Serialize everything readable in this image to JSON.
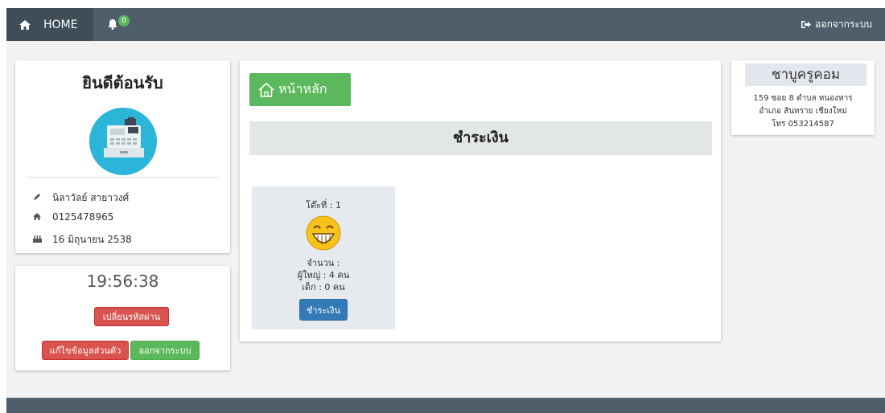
{
  "navbar": {
    "home_label": "HOME",
    "home_icon": "home-icon",
    "bell_icon": "bell-icon",
    "notification_count": "0",
    "logout_label": "ออกจากระบบ",
    "logout_icon": "sign-out-icon",
    "color": "#4e5f6b"
  },
  "profile": {
    "welcome": "ยินดีต้อนรับ",
    "avatar_icon": "cash-register-icon",
    "name": "นิลาวัลย์ สายาวงศ์",
    "name_icon": "pencil-icon",
    "phone": "0125478965",
    "phone_icon": "home-icon",
    "birthday": "16 มิถุนายน 2538",
    "birthday_icon": "cake-icon"
  },
  "clock_panel": {
    "time": "19:56:38",
    "change_password_label": "เปลี่ยนรหัสผ่าน",
    "edit_profile_label": "แก้ไขข้อมูลส่วนตัว",
    "logout_label": "ออกจากระบบ"
  },
  "main": {
    "home_button_label": "หน้าหลัก",
    "section_title": "ชำระเงิน",
    "tables": [
      {
        "table_label": "โต๊ะที่ : 1",
        "count_label": "จำนวน :",
        "adults": "ผู้ใหญ่ : 4 คน",
        "children": "เด็ก : 0 คน",
        "pay_label": "ชำระเงิน",
        "icon": "grinning-face-icon"
      }
    ]
  },
  "shop": {
    "name": "ชาบูครูคอม",
    "address_line1": "159 ซอย 8 ตำบล หนองหาร",
    "address_line2": "อำเภอ สันทราย เชียงใหม่",
    "phone": "โทร 053214587"
  },
  "colors": {
    "success": "#5cb85c",
    "danger": "#d9534f",
    "primary": "#337ab7",
    "avatar": "#2bb5d9"
  }
}
